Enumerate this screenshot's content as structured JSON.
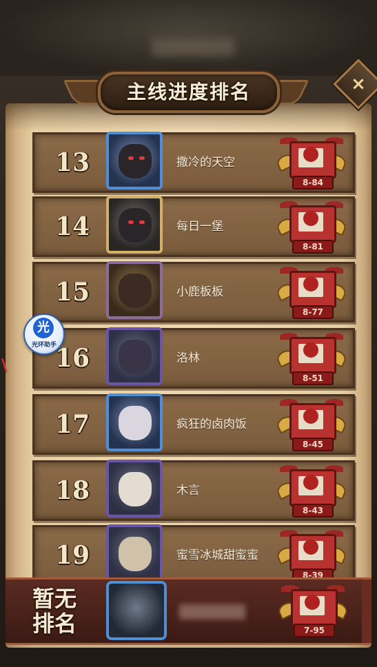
{
  "title": "主线进度排名",
  "close_icon": "×",
  "rows": [
    {
      "rank": "13",
      "name": "撒冷的天空",
      "progress": "8-84",
      "frame": "blue"
    },
    {
      "rank": "14",
      "name": "每日一堡",
      "progress": "8-81",
      "frame": "gold"
    },
    {
      "rank": "15",
      "name": "小鹿板板",
      "progress": "8-77",
      "frame": "brown"
    },
    {
      "rank": "16",
      "name": "洛林",
      "progress": "8-51",
      "frame": "purple"
    },
    {
      "rank": "17",
      "name": "疯狂的卤肉饭",
      "progress": "8-45",
      "frame": "blue"
    },
    {
      "rank": "18",
      "name": "木言",
      "progress": "8-43",
      "frame": "purple"
    },
    {
      "rank": "19",
      "name": "蜜雪冰城甜蜜蜜",
      "progress": "8-39",
      "frame": "purple"
    }
  ],
  "my_rank": {
    "label_line1": "暂无",
    "label_line2": "排名",
    "progress": "7-95"
  },
  "helper": {
    "glyph": "光",
    "label": "光环助手"
  },
  "edge_mark": "\\"
}
